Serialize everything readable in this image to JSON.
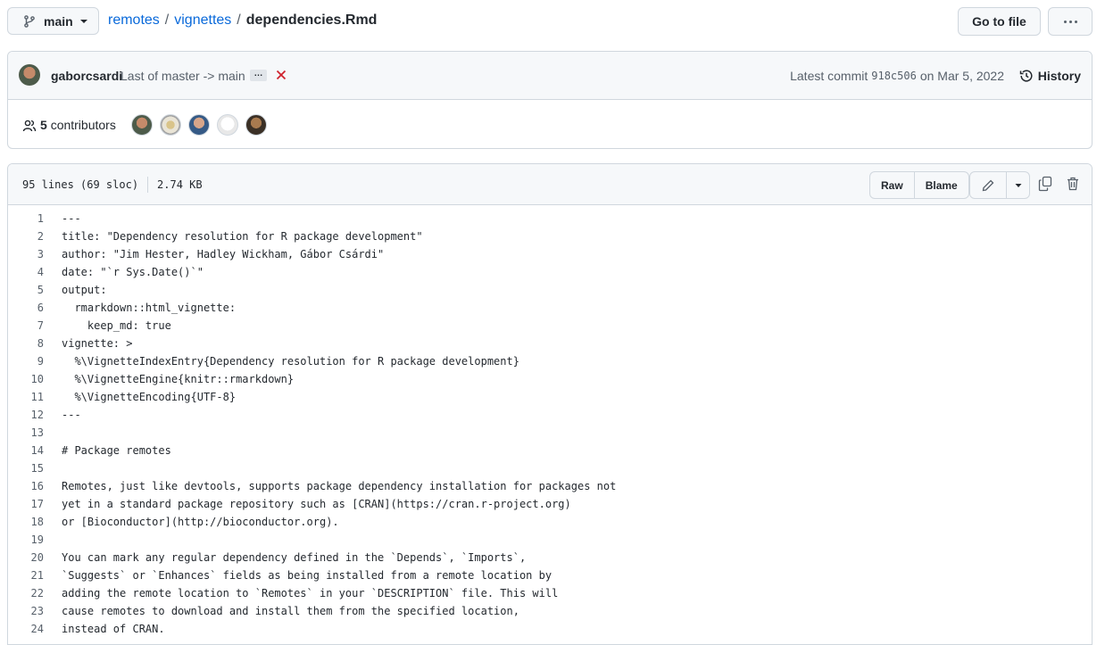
{
  "header": {
    "branch": "main",
    "breadcrumb": {
      "repo": "remotes",
      "folder": "vignettes",
      "file": "dependencies.Rmd"
    },
    "goto_file": "Go to file"
  },
  "commit": {
    "author": "gaborcsardi",
    "message": "Last of master -> main",
    "ellipsis": "…",
    "latest_label": "Latest commit",
    "sha": "918c506",
    "date_text": "on Mar 5, 2022",
    "history_label": "History"
  },
  "contributors": {
    "count": "5",
    "label": "contributors"
  },
  "file": {
    "lines_info": "95 lines (69 sloc)",
    "size": "2.74 KB",
    "raw_label": "Raw",
    "blame_label": "Blame"
  },
  "code_lines": [
    {
      "n": "1",
      "text": "---"
    },
    {
      "n": "2",
      "text": "title: \"Dependency resolution for R package development\""
    },
    {
      "n": "3",
      "text": "author: \"Jim Hester, Hadley Wickham, Gábor Csárdi\""
    },
    {
      "n": "4",
      "text": "date: \"`r Sys.Date()`\""
    },
    {
      "n": "5",
      "text": "output:"
    },
    {
      "n": "6",
      "text": "  rmarkdown::html_vignette:"
    },
    {
      "n": "7",
      "text": "    keep_md: true"
    },
    {
      "n": "8",
      "text": "vignette: >"
    },
    {
      "n": "9",
      "text": "  %\\VignetteIndexEntry{Dependency resolution for R package development}"
    },
    {
      "n": "10",
      "text": "  %\\VignetteEngine{knitr::rmarkdown}"
    },
    {
      "n": "11",
      "text": "  %\\VignetteEncoding{UTF-8}"
    },
    {
      "n": "12",
      "text": "---"
    },
    {
      "n": "13",
      "text": ""
    },
    {
      "n": "14",
      "text": "# Package remotes"
    },
    {
      "n": "15",
      "text": ""
    },
    {
      "n": "16",
      "text": "Remotes, just like devtools, supports package dependency installation for packages not"
    },
    {
      "n": "17",
      "text": "yet in a standard package repository such as [CRAN](https://cran.r-project.org)"
    },
    {
      "n": "18",
      "text": "or [Bioconductor](http://bioconductor.org)."
    },
    {
      "n": "19",
      "text": ""
    },
    {
      "n": "20",
      "text": "You can mark any regular dependency defined in the `Depends`, `Imports`,"
    },
    {
      "n": "21",
      "text": "`Suggests` or `Enhances` fields as being installed from a remote location by"
    },
    {
      "n": "22",
      "text": "adding the remote location to `Remotes` in your `DESCRIPTION` file. This will"
    },
    {
      "n": "23",
      "text": "cause remotes to download and install them from the specified location,"
    },
    {
      "n": "24",
      "text": "instead of CRAN."
    }
  ]
}
